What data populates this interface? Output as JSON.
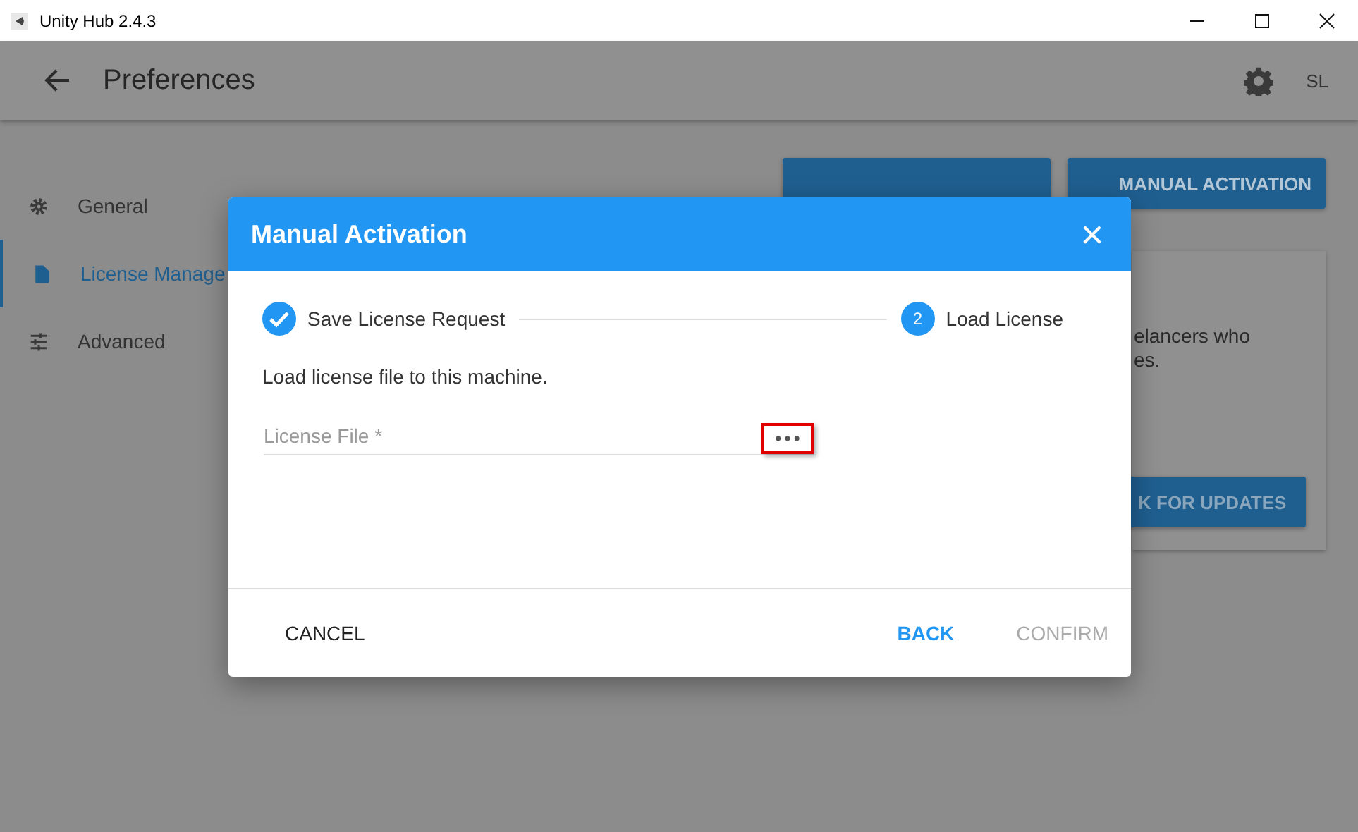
{
  "window": {
    "title": "Unity Hub 2.4.3"
  },
  "header": {
    "title": "Preferences",
    "avatar": "SL"
  },
  "sidebar": {
    "items": [
      {
        "label": "General",
        "selected": false
      },
      {
        "label": "License Manage",
        "selected": true
      },
      {
        "label": "Advanced",
        "selected": false
      }
    ]
  },
  "page": {
    "buttons": [
      "MANUAL ACTIVATION"
    ],
    "card": {
      "lines": [
        "elancers who",
        "es."
      ],
      "button": "K FOR UPDATES"
    }
  },
  "dialog": {
    "title": "Manual Activation",
    "steps": [
      {
        "label": "Save License Request",
        "completed": true
      },
      {
        "label": "Load License",
        "number": "2",
        "completed": false
      }
    ],
    "description": "Load license file to this machine.",
    "field": {
      "placeholder": "License File *",
      "highlighted": true
    },
    "buttons": [
      {
        "label": "CANCEL",
        "kind": "plain",
        "disabled": false
      },
      {
        "label": "BACK",
        "kind": "primary",
        "disabled": false
      },
      {
        "label": "CONFIRM",
        "kind": "primary",
        "disabled": true
      }
    ]
  }
}
